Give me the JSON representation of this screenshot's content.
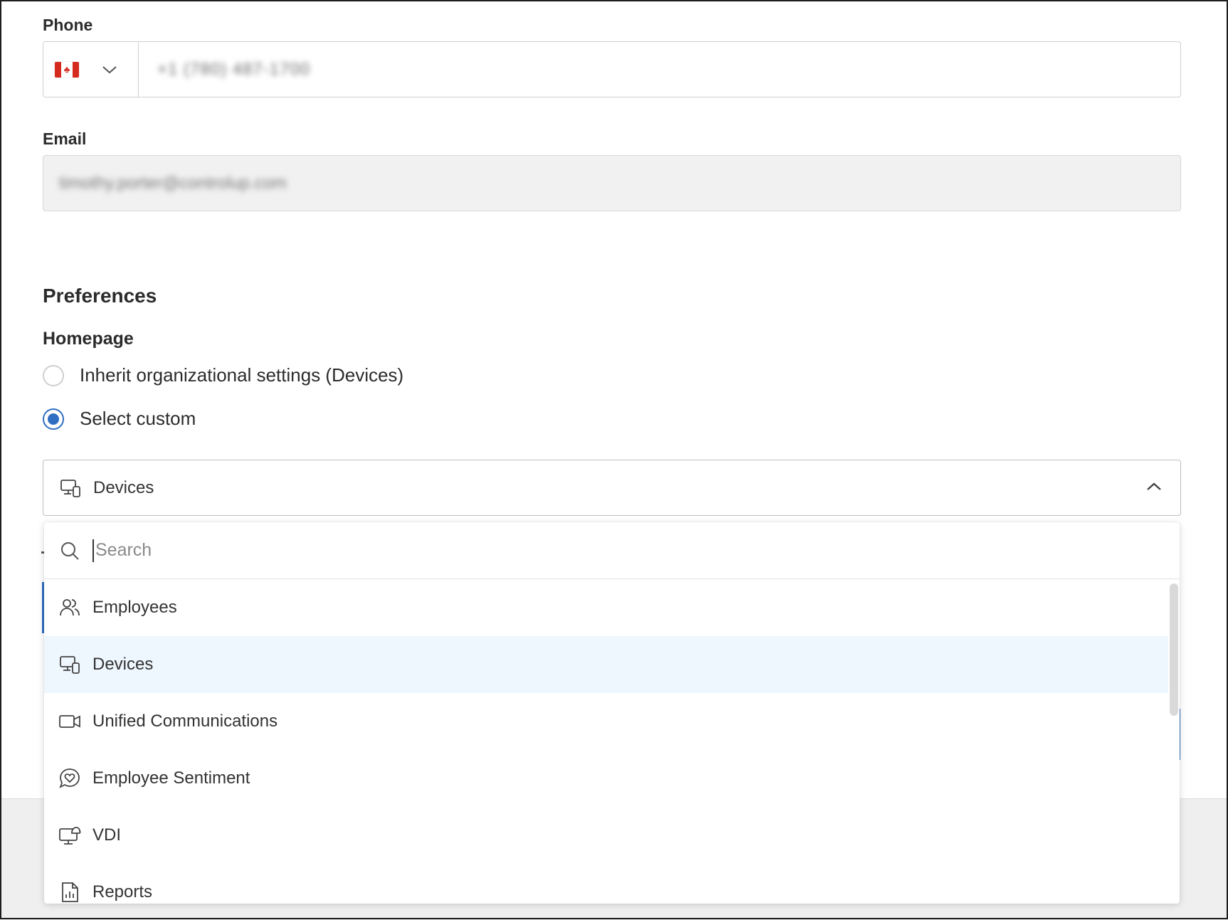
{
  "phone": {
    "label": "Phone",
    "country": "Canada",
    "number": "+1 (780) 487-1700"
  },
  "email": {
    "label": "Email",
    "value": "timothy.porter@controlup.com"
  },
  "preferences": {
    "title": "Preferences",
    "homepage": {
      "title": "Homepage",
      "options": [
        {
          "label": "Inherit organizational settings (Devices)",
          "checked": false
        },
        {
          "label": "Select custom",
          "checked": true
        }
      ],
      "selected": {
        "label": "Devices",
        "icon": "devices-icon"
      },
      "dropdown": {
        "search_placeholder": "Search",
        "items": [
          {
            "label": "Employees",
            "icon": "employees-icon",
            "highlighted": false
          },
          {
            "label": "Devices",
            "icon": "devices-icon",
            "highlighted": true
          },
          {
            "label": "Unified Communications",
            "icon": "video-camera-icon",
            "highlighted": false
          },
          {
            "label": "Employee Sentiment",
            "icon": "heart-chat-icon",
            "highlighted": false
          },
          {
            "label": "VDI",
            "icon": "cloud-monitor-icon",
            "highlighted": false
          },
          {
            "label": "Reports",
            "icon": "report-document-icon",
            "highlighted": false
          }
        ]
      }
    }
  },
  "colors": {
    "accent": "#2f6ec1",
    "highlight": "#eef6fe",
    "disabled_field": "#f1f1f1"
  }
}
